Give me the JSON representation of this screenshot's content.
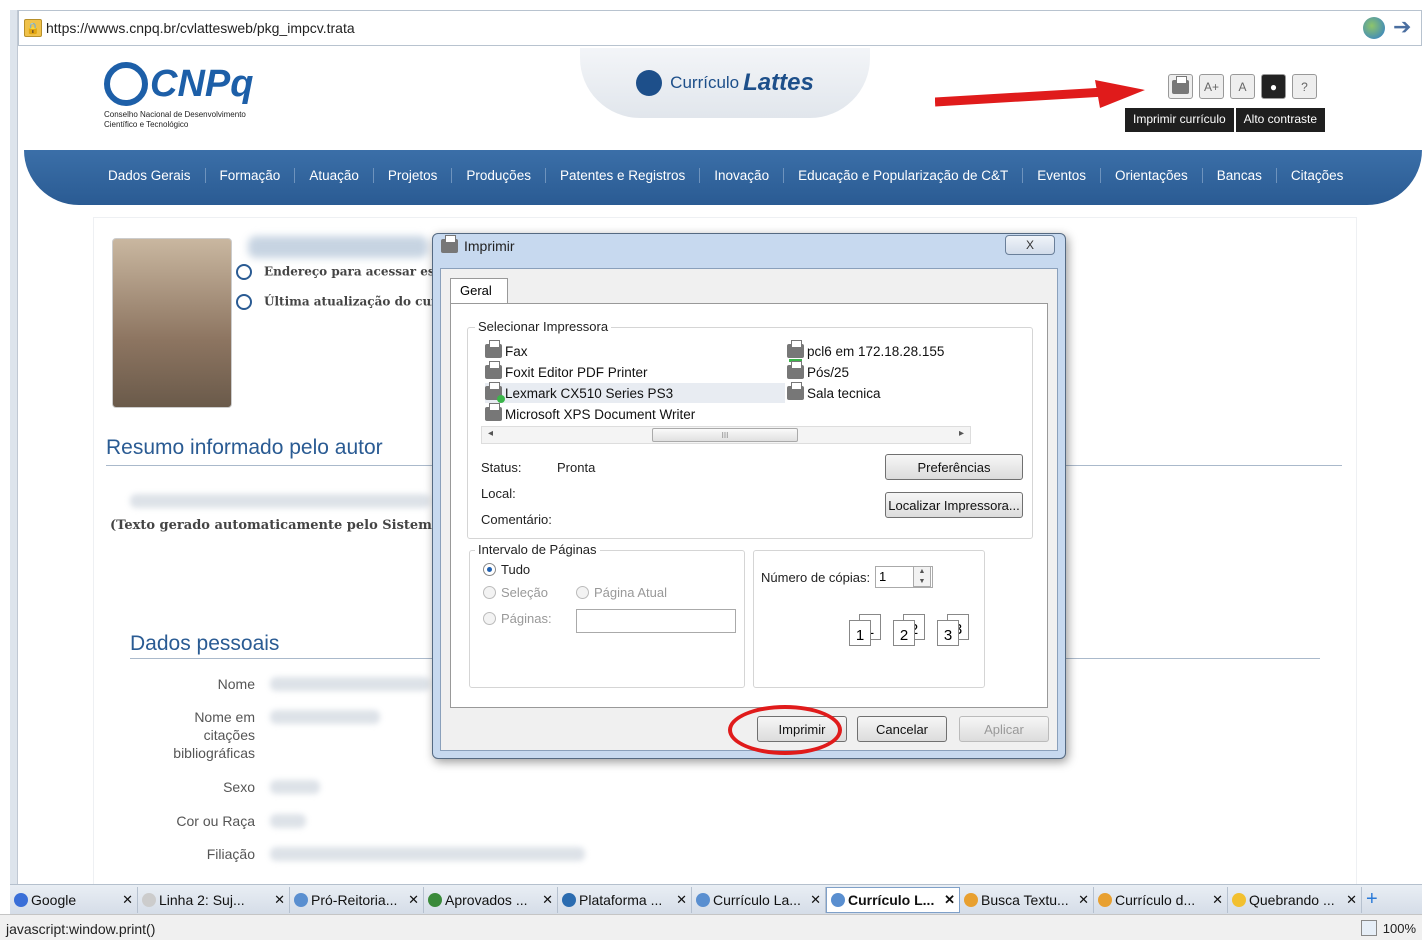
{
  "browser": {
    "url": "https://wwws.cnpq.br/cvlattesweb/pkg_impcv.trata"
  },
  "site": {
    "logo_text": "CNPq",
    "logo_sub_1": "Conselho Nacional de Desenvolvimento",
    "logo_sub_2": "Científico e Tecnológico",
    "lattes_prefix": "Currículo",
    "lattes_name": "Lattes",
    "tools": [
      "A+",
      "A",
      "?"
    ],
    "tooltip_print": "Imprimir currículo",
    "tooltip_contrast": "Alto contraste",
    "nav": [
      "Dados Gerais",
      "Formação",
      "Atuação",
      "Projetos",
      "Produções",
      "Patentes e Registros",
      "Inovação",
      "Educação e Popularização de C&T",
      "Eventos",
      "Orientações",
      "Bancas",
      "Citações"
    ]
  },
  "profile": {
    "address_label": "Endereço para acessar este",
    "update_label": "Última atualização do currí",
    "summary_title": "Resumo informado pelo autor",
    "auto_text": "(Texto gerado automaticamente pelo Sistema",
    "personal_title": "Dados pessoais",
    "fields": [
      "Nome",
      "Nome em citações bibliográficas",
      "Sexo",
      "Cor ou Raça",
      "Filiação"
    ],
    "field_nome": "Nome",
    "field_cit_1": "Nome em",
    "field_cit_2": "citações",
    "field_cit_3": "bibliográficas",
    "field_sexo": "Sexo",
    "field_cor": "Cor ou Raça",
    "field_filiacao": "Filiação"
  },
  "dialog": {
    "title": "Imprimir",
    "close": "X",
    "tab": "Geral",
    "select_printer_label": "Selecionar Impressora",
    "printers_left": [
      "Fax",
      "Foxit Editor PDF Printer",
      "Lexmark CX510 Series PS3",
      "Microsoft XPS Document Writer"
    ],
    "printers_right": [
      "pcl6 em 172.18.28.155",
      "Pós/25",
      "Sala tecnica"
    ],
    "selected_printer": "Lexmark CX510 Series PS3",
    "status_label": "Status:",
    "status_value": "Pronta",
    "local_label": "Local:",
    "comment_label": "Comentário:",
    "preferences_button": "Preferências",
    "find_printer_button": "Localizar Impressora...",
    "page_range_label": "Intervalo de Páginas",
    "radio_all": "Tudo",
    "radio_selection": "Seleção",
    "radio_current": "Página Atual",
    "radio_pages": "Páginas:",
    "copies_label": "Número de cópias:",
    "copies_value": "1",
    "collate_pages": [
      "1",
      "1",
      "2",
      "2",
      "3",
      "3"
    ],
    "print_button": "Imprimir",
    "cancel_button": "Cancelar",
    "apply_button": "Aplicar",
    "scroll_thumb": "III"
  },
  "tabs": [
    {
      "label": "Google",
      "color": "#3a6fd8",
      "active": false
    },
    {
      "label": "Linha 2: Suj...",
      "color": "#cccccc",
      "active": false
    },
    {
      "label": "Pró-Reitoria...",
      "color": "#5a8fd0",
      "active": false
    },
    {
      "label": "Aprovados ...",
      "color": "#3a8a3a",
      "active": false
    },
    {
      "label": "Plataforma ...",
      "color": "#2b6cb0",
      "active": false
    },
    {
      "label": "Currículo La...",
      "color": "#5a8fd0",
      "active": false
    },
    {
      "label": "Currículo L...",
      "color": "#5a8fd0",
      "active": true
    },
    {
      "label": "Busca Textu...",
      "color": "#e8a030",
      "active": false
    },
    {
      "label": "Currículo d...",
      "color": "#e8a030",
      "active": false
    },
    {
      "label": "Quebrando ...",
      "color": "#f2c030",
      "active": false
    }
  ],
  "status": {
    "text": "javascript:window.print()",
    "zoom": "100%"
  },
  "colors": {
    "nav_blue": "#2a5b93",
    "annotation_red": "#e01b1b"
  }
}
